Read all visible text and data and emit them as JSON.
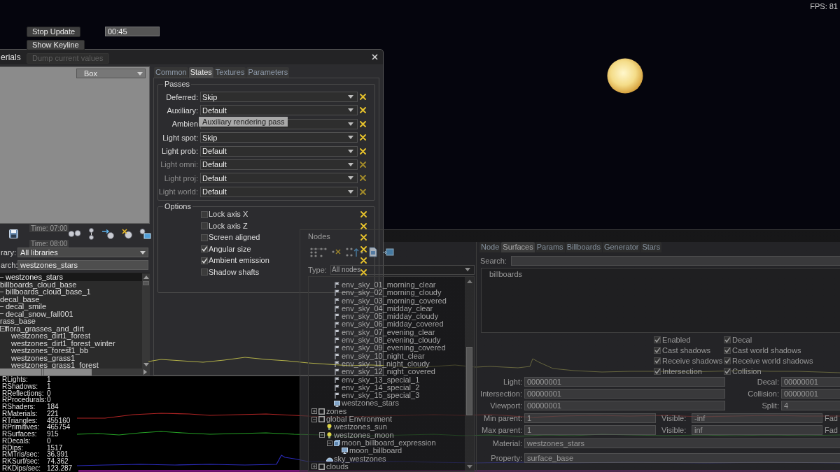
{
  "viewport": {
    "fps": "FPS: 81"
  },
  "top_controls": {
    "buttons": [
      {
        "label": "Stop Update",
        "disabled": false
      },
      {
        "label": "Show Keyline",
        "disabled": false
      },
      {
        "label": "Dump current values",
        "disabled": true
      }
    ],
    "time_field": {
      "value": "00:45"
    }
  },
  "time_panel": {
    "buttons": [
      "Time: 07:00",
      "Time: 08:00"
    ]
  },
  "materials_window": {
    "title": "erials",
    "preview": {
      "shape": "Box"
    },
    "library": {
      "label": "rary:",
      "value": "All libraries"
    },
    "search": {
      "label": "arch:",
      "value": "westzones_stars"
    },
    "tree": [
      {
        "children": [
          {
            "label": "westzones_stars",
            "selected": true
          }
        ]
      },
      {
        "label": "billboards_cloud_base",
        "selected": false,
        "children": [
          {
            "label": "billboards_cloud_base_1",
            "selected": false
          }
        ]
      },
      {
        "label": "decal_base",
        "selected": false,
        "children": [
          {
            "label": "decal_smile",
            "selected": false
          },
          {
            "label": "decal_snow_fall001",
            "selected": false
          }
        ]
      },
      {
        "label": "rass_base",
        "selected": false,
        "children": [
          {
            "label": "flora_grasses_and_dirt",
            "selected": false,
            "expanded": true,
            "children": [
              {
                "label": "westzones_dirt1_forest",
                "selected": false
              },
              {
                "label": "westzones_dirt1_forest_winter",
                "selected": false
              },
              {
                "label": "westzones_forest1_bb",
                "selected": false
              },
              {
                "label": "westzones_grass1",
                "selected": false
              },
              {
                "label": "westzones_grass1_forest",
                "selected": false
              }
            ]
          }
        ]
      }
    ],
    "tabs": [
      {
        "label": "Common",
        "selected": false
      },
      {
        "label": "States",
        "selected": true
      },
      {
        "label": "Textures",
        "selected": false
      },
      {
        "label": "Parameters",
        "selected": false
      }
    ],
    "passes": {
      "title": "Passes",
      "rows": [
        {
          "label": "Deferred:",
          "value": "Skip",
          "disabled": false
        },
        {
          "label": "Auxiliary:",
          "value": "Default",
          "disabled": false
        },
        {
          "label": "Ambien",
          "disabled": false
        },
        {
          "label": "Light spot:",
          "value": "Skip",
          "disabled": false
        },
        {
          "label": "Light prob:",
          "value": "Default",
          "disabled": false
        },
        {
          "label": "Light omni:",
          "value": "Default",
          "disabled": true
        },
        {
          "label": "Light proj:",
          "value": "Default",
          "disabled": true
        },
        {
          "label": "Light world:",
          "value": "Default",
          "disabled": true
        }
      ]
    },
    "tooltip": "Auxiliary rendering pass",
    "options": {
      "title": "Options",
      "rows": [
        {
          "label": "Lock axis X",
          "checked": false
        },
        {
          "label": "Lock axis Z",
          "checked": false
        },
        {
          "label": "Screen aligned",
          "checked": false
        },
        {
          "label": "Angular size",
          "checked": true
        },
        {
          "label": "Ambient emission",
          "checked": true
        },
        {
          "label": "Shadow shafts",
          "checked": false
        }
      ]
    }
  },
  "nodes_window": {
    "title": "Nodes",
    "type": {
      "label": "Type:",
      "value": "All nodes"
    },
    "tree": [
      {
        "children": [
          {
            "children": [
              {
                "label": "env_sky_01_morning_clear",
                "kind": "sky",
                "selected": false
              },
              {
                "label": "env_sky_02_morning_cloudy",
                "kind": "sky",
                "selected": false
              },
              {
                "label": "env_sky_03_morning_covered",
                "kind": "sky",
                "selected": false
              },
              {
                "label": "env_sky_04_midday_clear",
                "kind": "sky",
                "selected": false
              },
              {
                "label": "env_sky_05_midday_cloudy",
                "kind": "sky",
                "selected": false
              },
              {
                "label": "env_sky_06_midday_covered",
                "kind": "sky",
                "selected": false
              },
              {
                "label": "env_sky_07_evening_clear",
                "kind": "sky",
                "selected": false
              },
              {
                "label": "env_sky_08_evening_cloudy",
                "kind": "sky",
                "selected": false
              },
              {
                "label": "env_sky_09_evening_covered",
                "kind": "sky",
                "selected": false
              },
              {
                "label": "env_sky_10_night_clear",
                "kind": "sky",
                "selected": false
              },
              {
                "label": "env_sky_11_night_cloudy",
                "kind": "sky",
                "selected": false
              },
              {
                "label": "env_sky_12_night_covered",
                "kind": "sky",
                "selected": false
              },
              {
                "label": "env_sky_13_special_1",
                "kind": "sky",
                "selected": false
              },
              {
                "label": "env_sky_14_special_2",
                "kind": "sky",
                "selected": false
              },
              {
                "label": "env_sky_15_special_3",
                "kind": "sky",
                "selected": false
              },
              {
                "label": "westzones_stars",
                "kind": "billboard",
                "selected": false
              }
            ]
          }
        ]
      },
      {
        "label": "zones",
        "kind": "dummy",
        "expanded": false,
        "selected": false
      },
      {
        "label": "global Environment",
        "kind": "dummy",
        "expanded": true,
        "selected": false,
        "children": [
          {
            "label": "westzones_sun",
            "kind": "light",
            "selected": false
          },
          {
            "label": "westzones_moon",
            "kind": "light",
            "expanded": true,
            "selected": false,
            "children": [
              {
                "label": "moon_billboard_expression",
                "kind": "expression",
                "expanded": true,
                "selected": false,
                "children": [
                  {
                    "label": "moon_billboard",
                    "kind": "billboard",
                    "selected": false
                  }
                ]
              }
            ]
          },
          {
            "label": "sky_westzones",
            "kind": "skydome",
            "selected": false
          }
        ]
      },
      {
        "label": "clouds",
        "kind": "dummy",
        "expanded": false,
        "selected": false
      }
    ],
    "tabs": [
      {
        "label": "Node",
        "selected": false
      },
      {
        "label": "Surfaces",
        "selected": true
      },
      {
        "label": "Params",
        "selected": false
      },
      {
        "label": "Billboards",
        "selected": false
      },
      {
        "label": "Generator",
        "selected": false
      },
      {
        "label": "Stars",
        "selected": false
      }
    ],
    "search": {
      "label": "Search:"
    },
    "surfaces": [
      {
        "label": "billboards",
        "selected": false
      }
    ],
    "flags": [
      {
        "label": "Enabled",
        "checked": true
      },
      {
        "label": "Decal",
        "checked": true
      },
      {
        "label": "Cast shadows",
        "checked": true
      },
      {
        "label": "Cast world shadows",
        "checked": true
      },
      {
        "label": "Receive shadows",
        "checked": true
      },
      {
        "label": "Receive world shadows",
        "checked": true
      },
      {
        "label": "Intersection",
        "checked": true
      },
      {
        "label": "Collision",
        "checked": true
      }
    ],
    "masks": [
      {
        "label": "Light:",
        "value": "00000001",
        "side_label": "Decal:",
        "side_value": "00000001"
      },
      {
        "label": "Intersection:",
        "value": "00000001",
        "side_label": "Collision:",
        "side_value": "00000001"
      },
      {
        "label": "Viewport:",
        "value": "00000001",
        "side_label": "Split:",
        "side_value": "4"
      }
    ],
    "parents": [
      {
        "label": "Min parent:",
        "value": "1",
        "visible_label": "Visible:",
        "visible_value": "-inf",
        "fade_label": "Fad"
      },
      {
        "label": "Max parent:",
        "value": "1",
        "visible_label": "Visible:",
        "visible_value": "inf",
        "fade_label": "Fad"
      }
    ],
    "material": {
      "label": "Material:",
      "value": "westzones_stars"
    },
    "property": {
      "label": "Property:",
      "value": "surface_base"
    }
  },
  "stats": [
    {
      "name": "RLights:",
      "value": "1"
    },
    {
      "name": "RShadows:",
      "value": "1"
    },
    {
      "name": "RReflections:",
      "value": "0"
    },
    {
      "name": "RProcedurals:",
      "value": "0"
    },
    {
      "name": "RShaders:",
      "value": "184"
    },
    {
      "name": "RMaterials:",
      "value": "221"
    },
    {
      "name": "RTriangles:",
      "value": "455160"
    },
    {
      "name": "RPrimitives:",
      "value": "465754"
    },
    {
      "name": "RSurfaces:",
      "value": "915"
    },
    {
      "name": "RDecals:",
      "value": "0"
    },
    {
      "name": "RDips:",
      "value": "1517"
    },
    {
      "name": "RMTris/sec:",
      "value": "36.991"
    },
    {
      "name": "RKSurf/sec:",
      "value": "74.362"
    },
    {
      "name": "RKDips/sec:",
      "value": "123.287"
    }
  ]
}
